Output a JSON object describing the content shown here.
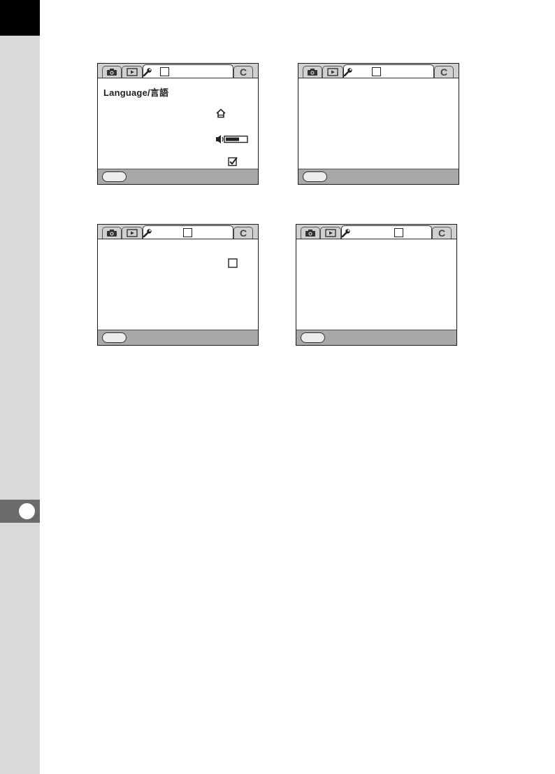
{
  "language_label": "Language/言語",
  "chapter_indicator": "chapter-circle",
  "screens": [
    {
      "id": "setup-menu-1",
      "tabs": [
        "camera-icon",
        "playback-icon",
        "wrench-icon",
        "custom"
      ],
      "custom_tab_label": "C",
      "items": [
        "Language/言語",
        "home-icon",
        "volume-icon",
        "checkbox-checked-icon"
      ]
    },
    {
      "id": "setup-menu-2",
      "tabs": [
        "camera-icon",
        "playback-icon",
        "wrench-icon",
        "custom"
      ],
      "custom_tab_label": "C"
    },
    {
      "id": "setup-menu-3",
      "tabs": [
        "camera-icon",
        "playback-icon",
        "wrench-icon",
        "custom"
      ],
      "custom_tab_label": "C",
      "items": [
        "checkbox-empty-icon"
      ]
    },
    {
      "id": "setup-menu-4",
      "tabs": [
        "camera-icon",
        "playback-icon",
        "wrench-icon",
        "custom"
      ],
      "custom_tab_label": "C"
    }
  ],
  "colors": {
    "tab_bar": "#d0d0d0",
    "footer": "#a8a8a8",
    "side_strip": "#d9d9d9",
    "chapter_tab": "#6b6b6b"
  }
}
